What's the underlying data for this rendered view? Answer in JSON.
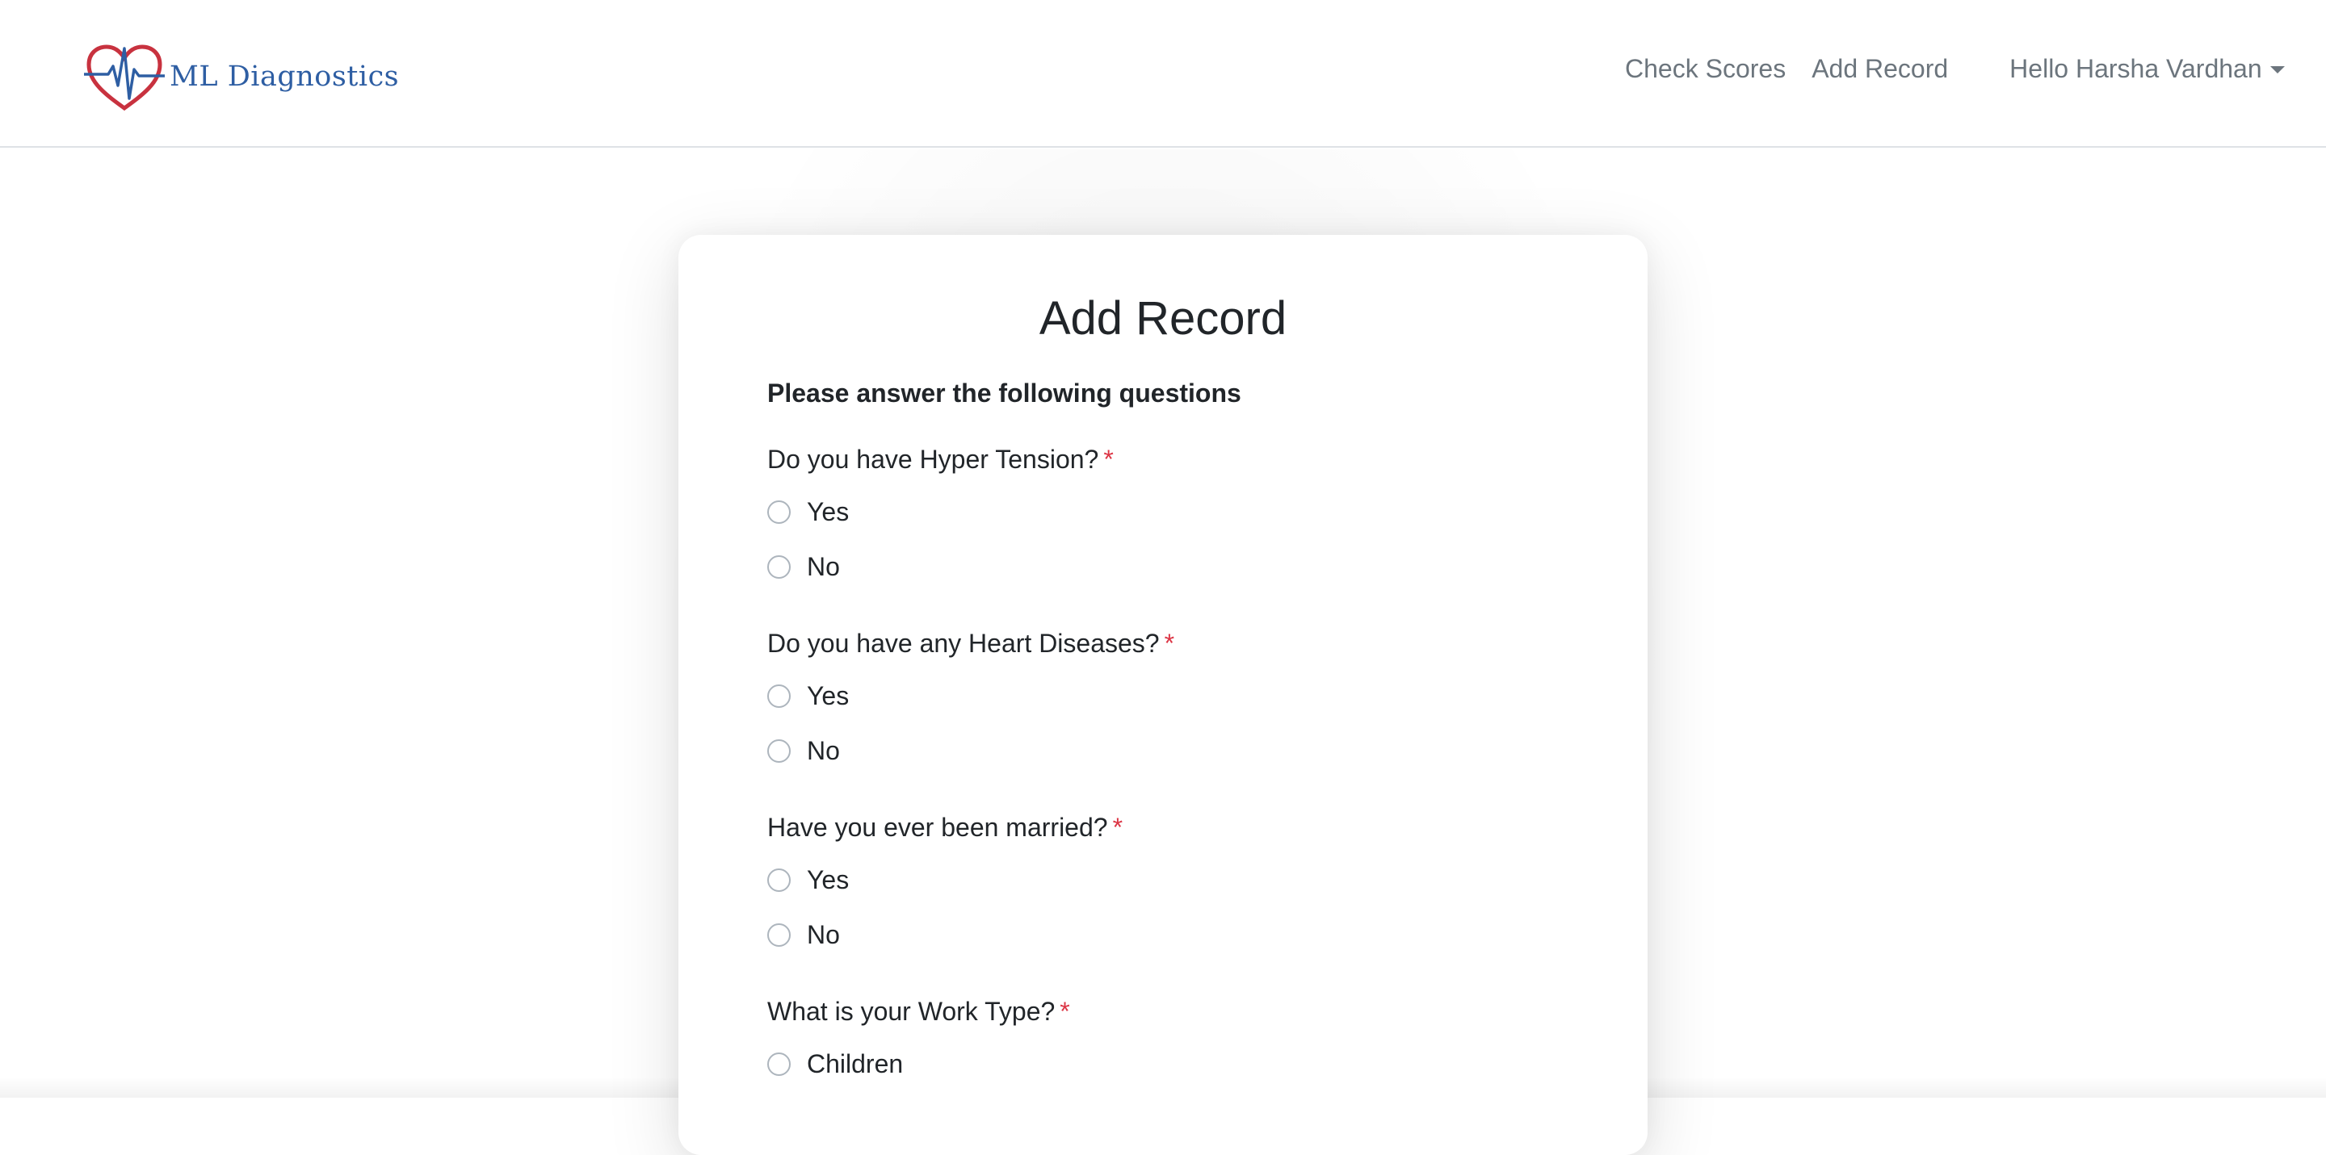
{
  "brand": {
    "name": "ML Diagnostics",
    "logo_icon": "heart-ecg-logo-icon",
    "colors": {
      "heart": "#c8323f",
      "pulse": "#2e5ea3"
    }
  },
  "nav": {
    "check_scores": "Check Scores",
    "add_record": "Add Record",
    "user_greeting": "Hello Harsha Vardhan",
    "user_menu_icon": "caret-down-icon"
  },
  "form": {
    "title": "Add Record",
    "intro": "Please answer the following questions",
    "required_marker": "*",
    "questions": [
      {
        "label": "Do you have Hyper Tension?",
        "options": [
          "Yes",
          "No"
        ]
      },
      {
        "label": "Do you have any Heart Diseases?",
        "options": [
          "Yes",
          "No"
        ]
      },
      {
        "label": "Have you ever been married?",
        "options": [
          "Yes",
          "No"
        ]
      },
      {
        "label": "What is your Work Type?",
        "options": [
          "Children"
        ]
      }
    ]
  },
  "colors": {
    "required": "#dc3545",
    "nav_text": "#6c757d",
    "text": "#212529"
  }
}
